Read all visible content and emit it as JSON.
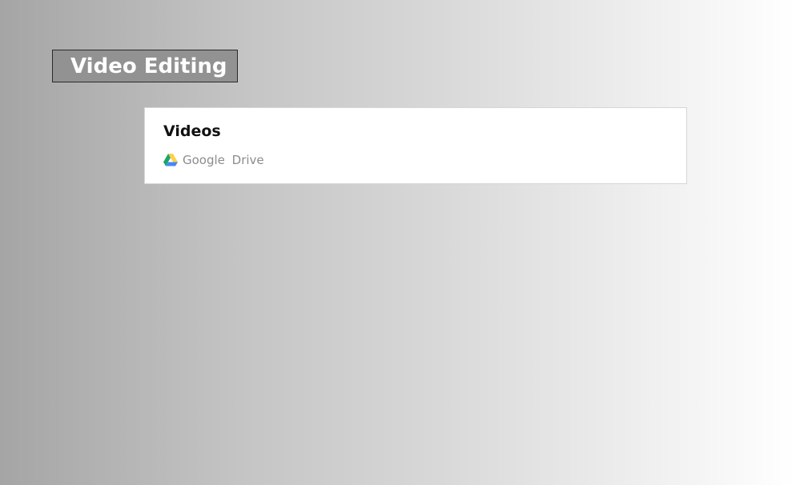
{
  "header": {
    "title": "Video Editing"
  },
  "card": {
    "title": "Videos",
    "source_icon": "google-drive-icon",
    "source_label": "Google  Drive"
  },
  "colors": {
    "header_bg": "#929292",
    "header_text": "#ffffff",
    "card_bg": "#ffffff",
    "source_text": "#8c8c8c",
    "drive_green": "#1fa463",
    "drive_yellow": "#ffd04b",
    "drive_blue": "#4688f4"
  }
}
